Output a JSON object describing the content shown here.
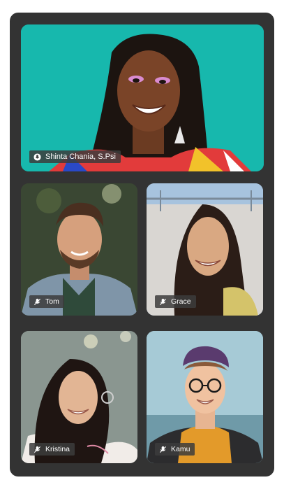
{
  "participants": {
    "main": {
      "name": "Shinta Chania, S.Psi",
      "icon": "mic-icon",
      "bg": "#17b8ad"
    },
    "tom": {
      "name": "Tom",
      "icon": "mic-muted-icon"
    },
    "grace": {
      "name": "Grace",
      "icon": "mic-muted-icon"
    },
    "kristina": {
      "name": "Kristina",
      "icon": "mic-muted-icon"
    },
    "kamu": {
      "name": "Kamu",
      "icon": "mic-muted-icon"
    }
  }
}
